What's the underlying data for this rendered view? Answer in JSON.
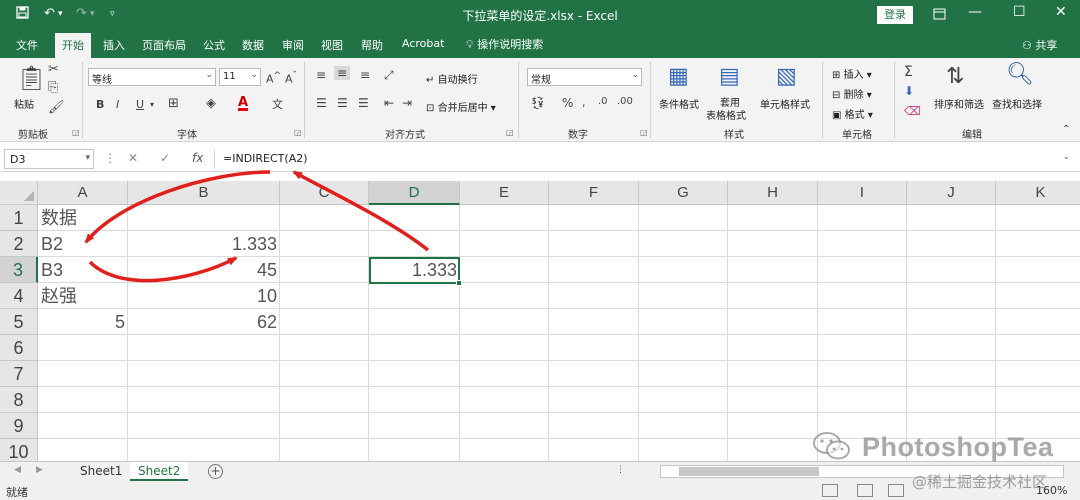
{
  "titlebar": {
    "title": "下拉菜单的设定.xlsx - Excel",
    "login": "登录",
    "qa_save_icon": "save-icon",
    "qa_undo_icon": "undo-icon",
    "qa_redo_icon": "redo-icon"
  },
  "menu": {
    "tabs": [
      "文件",
      "开始",
      "插入",
      "页面布局",
      "公式",
      "数据",
      "审阅",
      "视图",
      "帮助",
      "Acrobat"
    ],
    "active": "开始",
    "search": "操作说明搜索",
    "share": "共享"
  },
  "ribbon": {
    "clipboard": {
      "paste": "粘贴",
      "label": "剪贴板"
    },
    "font": {
      "name": "等线",
      "size": "11",
      "label": "字体",
      "bold": "B",
      "italic": "I",
      "underline": "U"
    },
    "alignment": {
      "wrap": "自动换行",
      "merge": "合并后居中",
      "label": "对齐方式"
    },
    "number": {
      "format": "常规",
      "label": "数字",
      "percent": "%"
    },
    "styles": {
      "conditional": "条件格式",
      "table": "套用\n表格格式",
      "table_line1": "套用",
      "table_line2": "表格格式",
      "cell_styles": "单元格样式",
      "label": "样式"
    },
    "cells": {
      "insert": "插入",
      "delete": "删除",
      "format": "格式",
      "label": "单元格"
    },
    "editing": {
      "sort": "排序和筛选",
      "find": "查找和选择",
      "label": "编辑",
      "sum": "Σ"
    }
  },
  "formula_bar": {
    "name_box": "D3",
    "formula": "=INDIRECT(A2)",
    "fx": "fx"
  },
  "sheet": {
    "columns": [
      "A",
      "B",
      "C",
      "D",
      "E",
      "F",
      "G",
      "H",
      "I",
      "J",
      "K"
    ],
    "rows": [
      "1",
      "2",
      "3",
      "4",
      "5",
      "6",
      "7",
      "8",
      "9",
      "10"
    ],
    "selected_cell": "D3",
    "cells": {
      "A1": "数据",
      "A2": "B2",
      "B2": "1.333",
      "A3": "B3",
      "B3": "45",
      "D3": "1.333",
      "A4": "赵强",
      "B4": "10",
      "A5": "5",
      "B5": "62"
    }
  },
  "tabs": {
    "sheets": [
      "Sheet1",
      "Sheet2"
    ],
    "active": "Sheet2"
  },
  "status": {
    "ready": "就绪",
    "zoom": "160%"
  },
  "watermark": {
    "brand": "PhotoshopTea",
    "community": "@稀土掘金技术社区"
  },
  "colors": {
    "excel_green": "#217346",
    "arrow_red": "#e0201c"
  }
}
